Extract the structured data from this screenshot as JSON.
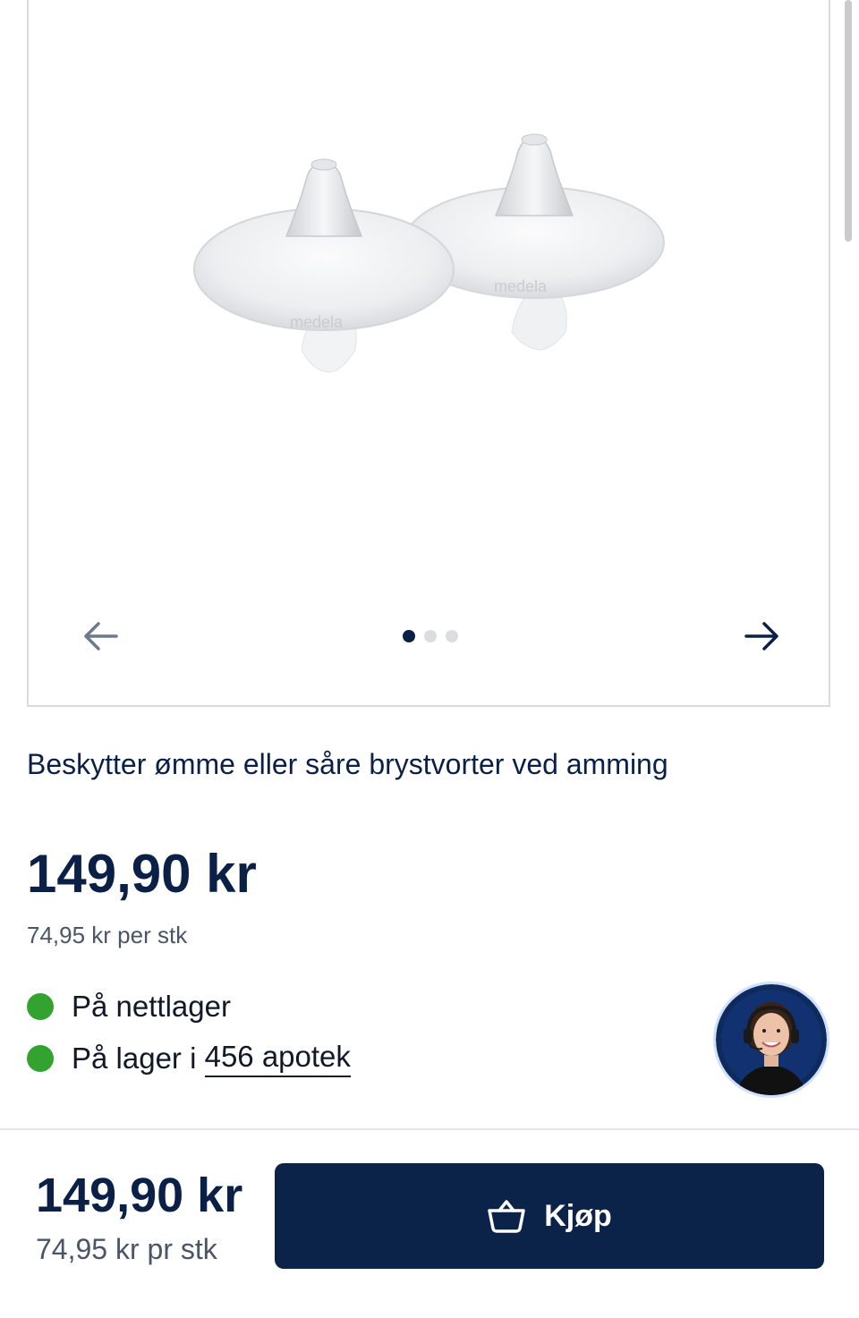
{
  "product": {
    "tagline": "Beskytter ømme eller såre brystvorter ved amming",
    "price": "149,90 kr",
    "unit_price": "74,95 kr per stk",
    "image": {
      "brand_left": "medela",
      "brand_right": "medela",
      "slide_count": 3,
      "active_slide": 1
    }
  },
  "availability": {
    "online": {
      "label": "På nettlager",
      "status_color": "#32a32e"
    },
    "stores": {
      "prefix": "På lager i ",
      "link_text": "456 apotek",
      "status_color": "#32a32e"
    }
  },
  "gallery_nav": {
    "prev_icon": "arrow-left-icon",
    "next_icon": "arrow-right-icon"
  },
  "footer": {
    "price": "149,90 kr",
    "unit_price": "74,95 kr pr stk",
    "buy_label": "Kjøp",
    "buy_icon": "basket-icon"
  },
  "colors": {
    "brand_navy": "#0b2249",
    "text": "#0b2046",
    "in_stock": "#32a32e"
  }
}
